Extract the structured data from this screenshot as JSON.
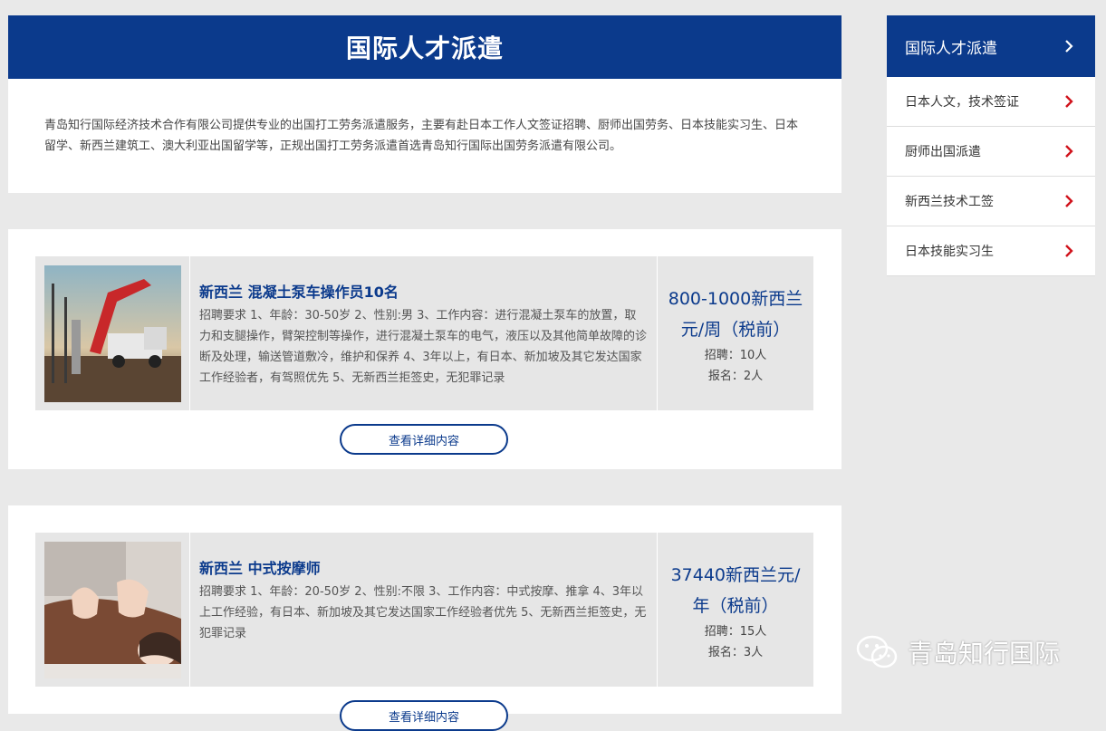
{
  "header": {
    "title": "国际人才派遣"
  },
  "intro": {
    "text": "青岛知行国际经济技术合作有限公司提供专业的出国打工劳务派遣服务，主要有赴日本工作人文签证招聘、厨师出国劳务、日本技能实习生、日本留学、新西兰建筑工、澳大利亚出国留学等，正规出国打工劳务派遣首选青岛知行国际出国劳务派遣有限公司。"
  },
  "jobs": [
    {
      "title": "新西兰 混凝土泵车操作员10名",
      "requirements": "招聘要求 1、年龄：30-50岁 2、性别:男 3、工作内容：进行混凝土泵车的放置，取力和支腿操作，臂架控制等操作，进行混凝土泵车的电气，液压以及其他简单故障的诊断及处理，输送管道敷冷，维护和保养 4、3年以上，有日本、新加坡及其它发达国家工作经验者，有驾照优先 5、无新西兰拒签史，无犯罪记录",
      "salary": "800-1000新西兰元/周（税前）",
      "recruit": "招聘：10人",
      "applied": "报名：2人",
      "button": "查看详细内容",
      "image_icon": "concrete-pump-truck-photo"
    },
    {
      "title": "新西兰 中式按摩师",
      "requirements": "招聘要求 1、年龄：20-50岁 2、性别:不限 3、工作内容：中式按摩、推拿 4、3年以上工作经验，有日本、新加坡及其它发达国家工作经验者优先 5、无新西兰拒签史，无犯罪记录",
      "salary": "37440新西兰元/年（税前）",
      "recruit": "招聘：15人",
      "applied": "报名：3人",
      "button": "查看详细内容",
      "image_icon": "massage-photo"
    }
  ],
  "sidebar": {
    "title": "国际人才派遣",
    "items": [
      {
        "label": "日本人文，技术签证"
      },
      {
        "label": "厨师出国派遣"
      },
      {
        "label": "新西兰技术工签"
      },
      {
        "label": "日本技能实习生"
      }
    ]
  },
  "watermark": {
    "text": "青岛知行国际",
    "icon": "wechat-icon"
  },
  "colors": {
    "brand": "#0b3a8c",
    "chevron": "#d0121b",
    "background": "#e9e9e9"
  }
}
